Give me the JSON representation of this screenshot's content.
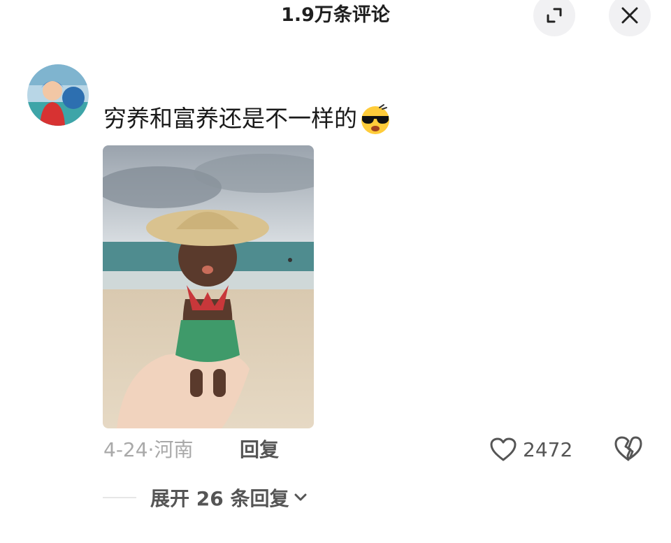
{
  "header": {
    "title": "1.9万条评论"
  },
  "comment": {
    "text": "穷养和富养还是不一样的",
    "emoji_icon": "cool-sunglasses-emoji",
    "date": "4-24",
    "location": "河南",
    "reply_label": "回复",
    "like_count": "2472",
    "expand_label": "展开 26 条回复"
  },
  "colors": {
    "meta_text": "#a9a9a9",
    "action_text": "#555555",
    "button_bg": "#f1f1f3"
  }
}
